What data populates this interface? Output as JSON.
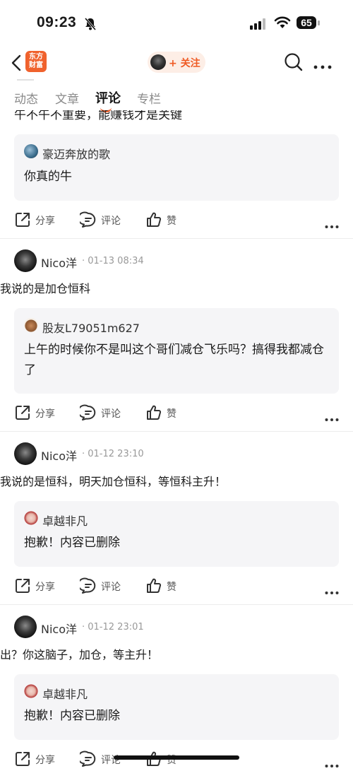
{
  "status_bar": {
    "time": "09:23",
    "battery": "65"
  },
  "nav": {
    "logo_line1": "东方",
    "logo_line2": "财富",
    "follow_label": "+ 关注"
  },
  "tabs": [
    {
      "label": "动态"
    },
    {
      "label": "文章"
    },
    {
      "label": "评论"
    },
    {
      "label": "专栏"
    }
  ],
  "top_post": {
    "clipped_text": "午不午不重要，能赚钱才是关键",
    "quote": {
      "name": "豪迈奔放的歌",
      "text": "你真的牛"
    }
  },
  "actions": {
    "share": "分享",
    "comment": "评论",
    "like": "赞"
  },
  "posts": [
    {
      "name": "Nico洋",
      "meta": "· 01-13 08:34",
      "text": "我说的是加仓恒科",
      "quote": {
        "name": "股友L79051m627",
        "text": "上午的时候你不是叫这个哥们减仓飞乐吗？搞得我都减仓了"
      }
    },
    {
      "name": "Nico洋",
      "meta": "· 01-12 23:10",
      "text": "我说的是恒科，明天加仓恒科，等恒科主升！",
      "quote": {
        "name": "卓越非凡",
        "text": "抱歉！内容已删除"
      }
    },
    {
      "name": "Nico洋",
      "meta": "· 01-12 23:01",
      "text": "出？你这脑子，加仓，等主升！",
      "quote": {
        "name": "卓越非凡",
        "text": "抱歉！内容已删除"
      }
    }
  ],
  "colors": {
    "accent": "#f0622d",
    "quote_bg": "#f5f5f7"
  }
}
